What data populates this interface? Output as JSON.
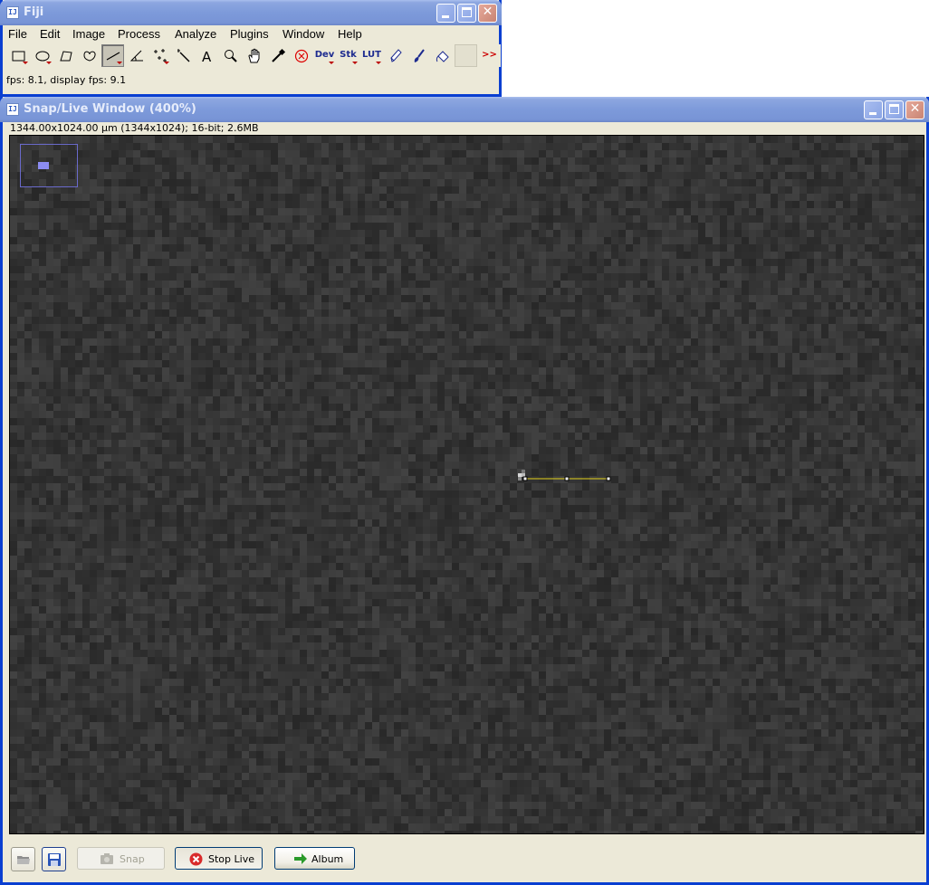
{
  "fiji_window": {
    "title": "Fiji",
    "menu": [
      "File",
      "Edit",
      "Image",
      "Process",
      "Analyze",
      "Plugins",
      "Window",
      "Help"
    ],
    "tools": {
      "dev_label": "Dev",
      "stk_label": "Stk",
      "lut_label": "LUT",
      "more_label": ">>"
    },
    "status": "fps: 8.1, display fps: 9.1"
  },
  "snap_window": {
    "title": "Snap/Live Window (400%)",
    "image_info": "1344.00x1024.00 µm (1344x1024); 16-bit; 2.6MB",
    "buttons": {
      "snap": "Snap",
      "stop_live": "Stop Live",
      "album": "Album"
    }
  },
  "colors": {
    "title_active": "#0a5ce6",
    "title_inactive": "#7d9ada",
    "line_roi": "#e6d41c",
    "image_background": "#333333",
    "stop_icon": "#d92b2b",
    "album_arrow": "#2a9a2a"
  }
}
